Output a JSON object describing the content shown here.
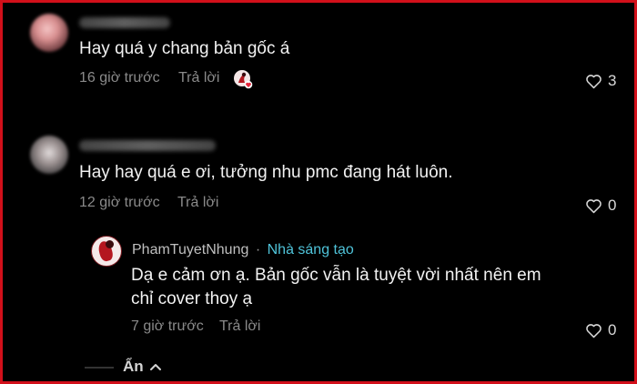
{
  "comments": [
    {
      "text": "Hay quá y chang bản gốc á",
      "time": "16 giờ trước",
      "reply_label": "Trả lời",
      "likes": "3"
    },
    {
      "text": "Hay hay quá e ơi, tưởng nhu pmc đang hát luôn.",
      "time": "12 giờ trước",
      "reply_label": "Trả lời",
      "likes": "0",
      "reply": {
        "author": "PhamTuyetNhung",
        "separator": "·",
        "creator_label": "Nhà sáng tạo",
        "line1": "Dạ e cảm ơn ạ. Bản gốc vẫn là tuyệt vời nhất nên em",
        "line2": "chỉ cover thoy ạ",
        "time": "7 giờ trước",
        "reply_label": "Trả lời",
        "likes": "0"
      }
    }
  ],
  "collapse_label": "Ẩn",
  "colors": {
    "border": "#d2101a",
    "creator": "#4fc3d9",
    "meta": "#8a8a8a"
  },
  "icons": {
    "like": "heart-outline-icon",
    "collapse": "chevron-up-icon",
    "creator_liked": "creator-liked-badge-icon"
  }
}
